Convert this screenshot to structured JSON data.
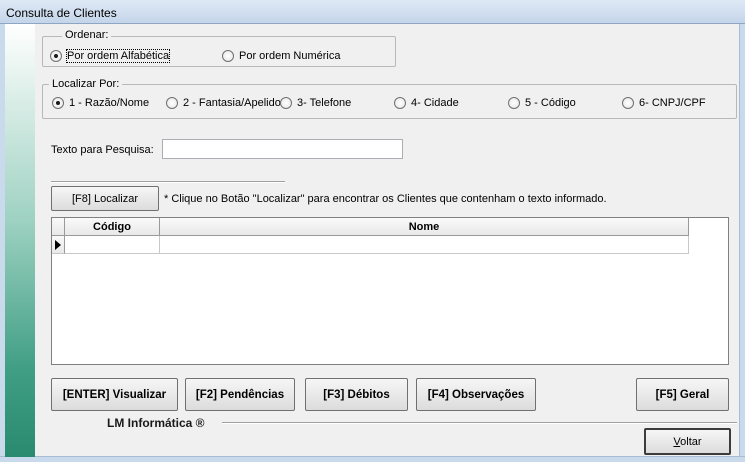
{
  "window": {
    "title": "Consulta de Clientes"
  },
  "ordenar": {
    "legend": "Ordenar:",
    "options": [
      {
        "label": "Por ordem Alfabética",
        "checked": true
      },
      {
        "label": "Por ordem Numérica",
        "checked": false
      }
    ]
  },
  "localizar_por": {
    "legend": "Localizar Por:",
    "options": [
      {
        "label": "1 - Razão/Nome",
        "checked": true
      },
      {
        "label": "2 - Fantasia/Apelido",
        "checked": false
      },
      {
        "label": "3- Telefone",
        "checked": false
      },
      {
        "label": "4- Cidade",
        "checked": false
      },
      {
        "label": "5 - Código",
        "checked": false
      },
      {
        "label": "6- CNPJ/CPF",
        "checked": false
      }
    ]
  },
  "search": {
    "label": "Texto para Pesquisa:",
    "value": ""
  },
  "localizar": {
    "button_label": "[F8]   Localizar",
    "hint": "* Clique no Botão \"Localizar\" para  encontrar os Clientes que contenham o texto informado."
  },
  "grid": {
    "columns": [
      "Código",
      "Nome"
    ],
    "rows": [
      {
        "codigo": "",
        "nome": ""
      }
    ]
  },
  "actions": {
    "visualizar": "[ENTER]  Visualizar",
    "pendencias": "[F2]  Pendências",
    "debitos": "[F3] Débitos",
    "observacoes": "[F4]  Observações",
    "geral": "[F5]  Geral"
  },
  "footer": {
    "brand": "LM Informática ®",
    "voltar_prefix": "",
    "voltar_mnemonic": "V",
    "voltar_rest": "oltar"
  }
}
